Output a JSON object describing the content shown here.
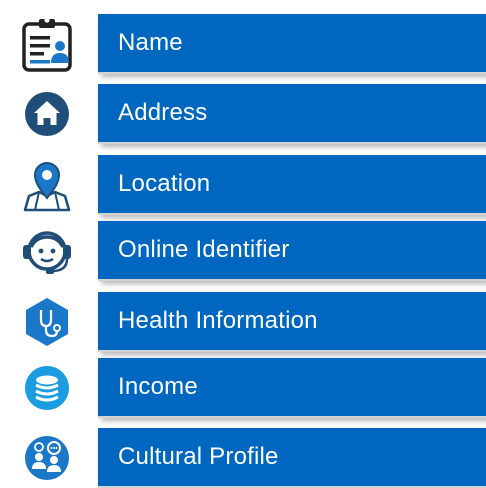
{
  "colors": {
    "bar": "#0067c0",
    "icon_dark": "#1f4e79",
    "icon_blue": "#1b78c9",
    "icon_light": "#2e9be6"
  },
  "items": [
    {
      "label": "Name",
      "icon": "id-badge-icon"
    },
    {
      "label": "Address",
      "icon": "home-icon"
    },
    {
      "label": "Location",
      "icon": "map-pin-icon"
    },
    {
      "label": "Online Identifier",
      "icon": "headset-user-icon"
    },
    {
      "label": "Health Information",
      "icon": "stethoscope-icon"
    },
    {
      "label": "Income",
      "icon": "coins-icon"
    },
    {
      "label": "Cultural Profile",
      "icon": "people-chat-icon"
    }
  ]
}
